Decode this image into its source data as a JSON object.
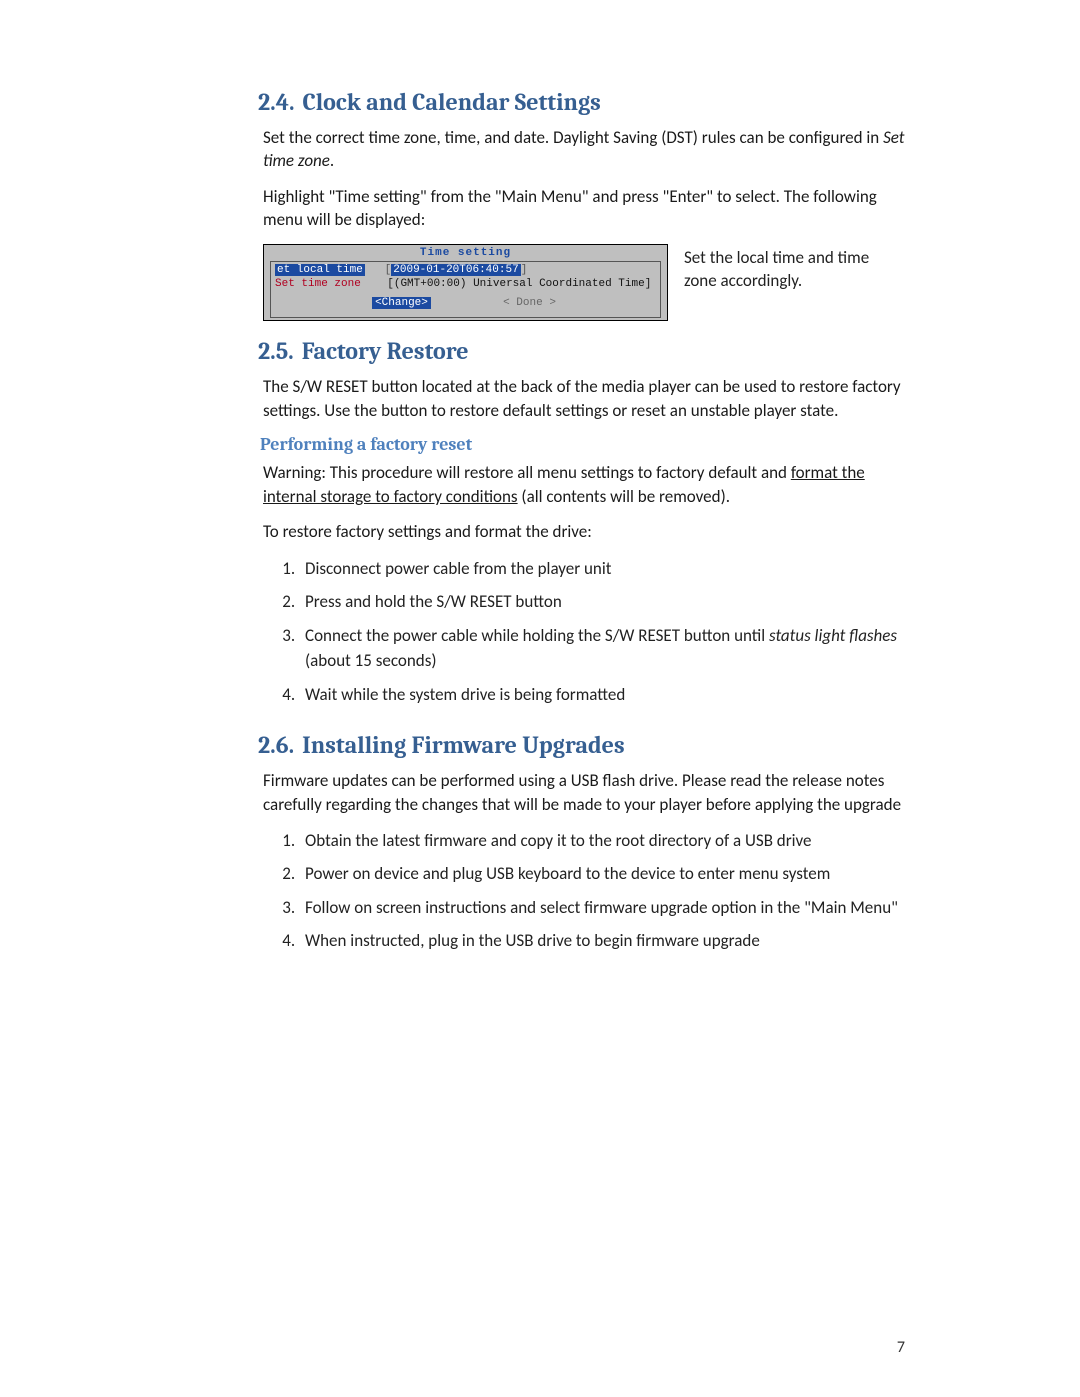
{
  "pageNumber": "7",
  "s24": {
    "number": "2.4.",
    "title": "Clock and Calendar Settings",
    "p1a": "Set the correct time zone, time, and date. Daylight Saving (DST) rules can be configured in ",
    "p1b": "Set time zone",
    "p1c": ".",
    "p2": "Highlight \"Time setting\" from the \"Main Menu\" and press \"Enter\" to select. The following menu will be displayed:",
    "term": {
      "title": "Time setting",
      "row1Label": "et local time",
      "row1ValueA": "[",
      "row1Value": "2009-01-20T06:40:57",
      "row1ValueB": "]",
      "row2Label": "Set time zone",
      "row2Value": "[(GMT+00:00) Universal Coordinated Time]",
      "btnChange": "<Change>",
      "btnDone": "< Done >"
    },
    "caption": "Set the local time and time zone accordingly."
  },
  "s25": {
    "number": "2.5.",
    "title": "Factory Restore",
    "p1": "The S/W RESET button located at the back of the media player can be used to restore factory settings. Use the button to restore default settings or reset an unstable player state.",
    "sub": "Performing a factory reset",
    "warnA": "Warning: This procedure will restore all menu settings to factory default and ",
    "warnU": "format the internal storage to factory conditions",
    "warnB": " (all contents will be removed).",
    "lead": "To restore factory settings and format the drive:",
    "li1": "Disconnect power cable from the player unit",
    "li2": "Press and hold the S/W RESET button",
    "li3a": "Connect the power cable while holding the S/W RESET button until ",
    "li3b": "status light flashes",
    "li3c": "  (about 15 seconds)",
    "li4": "Wait while the system drive is being formatted"
  },
  "s26": {
    "number": "2.6.",
    "title": "Installing Firmware Upgrades",
    "p1": "Firmware updates can be performed using a USB flash drive. Please read the release notes carefully regarding the changes that will be made to your player before applying the upgrade",
    "li1": "Obtain the latest firmware and copy it to the root directory of a USB drive",
    "li2": "Power on device and plug USB keyboard to the device to enter menu system",
    "li3": "Follow on screen instructions and select firmware upgrade option in the \"Main Menu\"",
    "li4": "When instructed, plug in the USB drive to begin firmware upgrade"
  }
}
